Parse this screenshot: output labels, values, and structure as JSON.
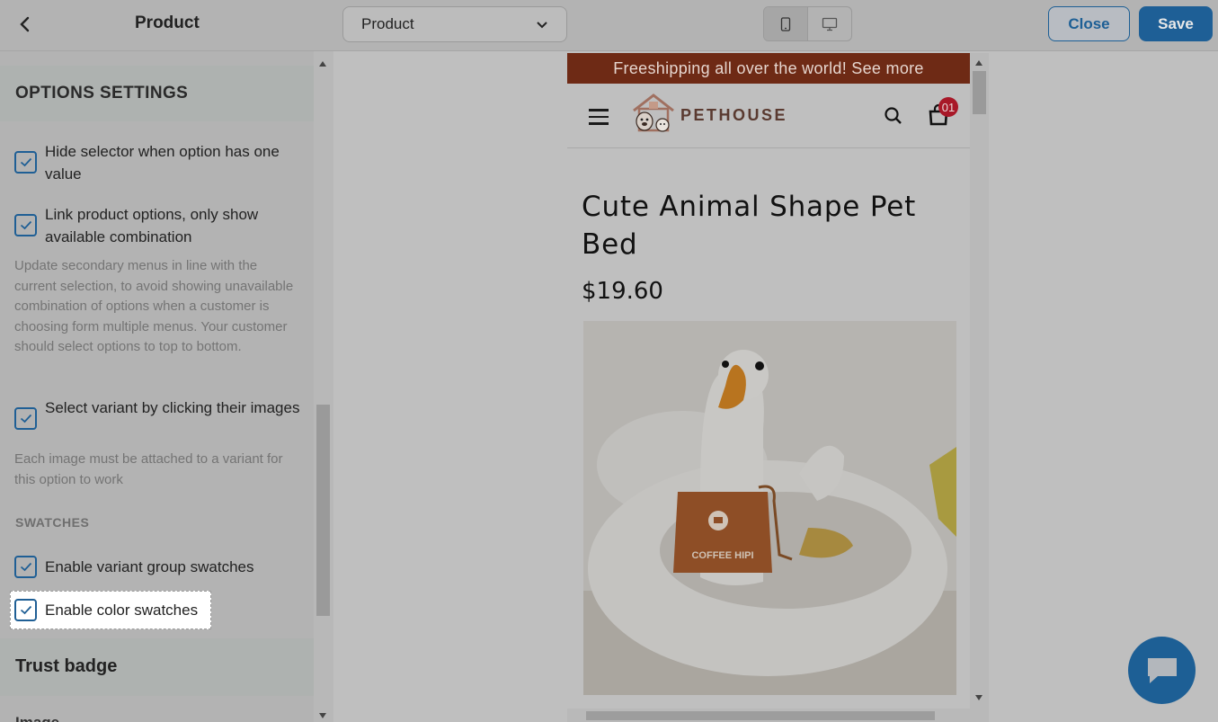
{
  "topbar": {
    "title": "Product",
    "page_select_value": "Product",
    "close_label": "Close",
    "save_label": "Save"
  },
  "options": {
    "section_title": "OPTIONS SETTINGS",
    "hide_selector": {
      "label": "Hide selector when option has one value",
      "checked": true
    },
    "link_options": {
      "label": "Link product options, only show available combination",
      "checked": true,
      "description": "Update secondary menus in line with the current selection, to avoid showing unavailable combination of options when a customer is choosing form multiple menus. Your customer should select options to top to bottom."
    },
    "select_variant": {
      "label": "Select variant by clicking their images",
      "checked": true,
      "description": "Each image must be attached to a variant for this option to work"
    },
    "swatches_heading": "SWATCHES",
    "variant_group_swatches": {
      "label": "Enable variant group swatches",
      "checked": true
    },
    "color_swatches": {
      "label": "Enable color swatches",
      "checked": true
    }
  },
  "trust_badge": {
    "title": "Trust badge"
  },
  "next_section": {
    "title": "Image"
  },
  "preview": {
    "promo": "Freeshipping all over the world! See more",
    "brand": "PETHOUSE",
    "cart_count": "01",
    "product_title": "Cute Animal Shape Pet Bed",
    "price": "$19.60",
    "apron_text": "COFFEE HIPI"
  },
  "colors": {
    "accent": "#1e5f96",
    "promo_bg": "#6e2a15",
    "badge": "#a81828"
  }
}
